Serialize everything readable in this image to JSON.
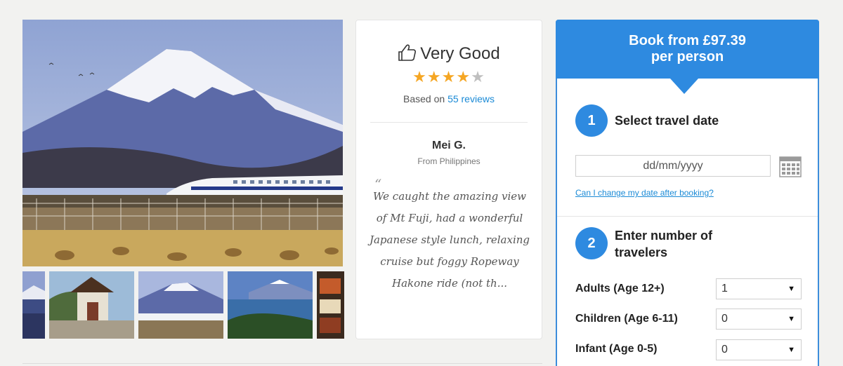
{
  "review": {
    "rating_label": "Very Good",
    "stars_filled": 4,
    "stars_total": 5,
    "based_prefix": "Based on",
    "reviews_link": "55 reviews",
    "reviewer_name": "Mei G.",
    "reviewer_origin": "From Philippines",
    "quote_mark": "“",
    "quote_lines": [
      "We caught the amazing view",
      "of Mt Fuji, had a wonderful",
      "Japanese style lunch, relaxing",
      "cruise but foggy Ropeway",
      "Hakone ride (not th..."
    ]
  },
  "booking": {
    "header_line1": "Book from £97.39",
    "header_line2": "per person",
    "step1_number": "1",
    "step1_title": "Select travel date",
    "date_placeholder": "dd/mm/yyyy",
    "change_date_link": "Can I change my date after booking?",
    "step2_number": "2",
    "step2_title_line1": "Enter number of",
    "step2_title_line2": "travelers",
    "travelers": [
      {
        "label": "Adults (Age 12+)",
        "value": "1"
      },
      {
        "label": "Children (Age 6-11)",
        "value": "0"
      },
      {
        "label": "Infant (Age 0-5)",
        "value": "0"
      }
    ],
    "caret": "▼"
  },
  "gallery": {
    "thumbnails": [
      "mt-fuji-lake",
      "temple-shrine",
      "mt-fuji-train",
      "mt-fuji-lake-hakone",
      "japanese-lunch"
    ]
  },
  "colors": {
    "accent": "#2e8ae0",
    "link": "#1a8ad6",
    "star": "#f5a623"
  }
}
